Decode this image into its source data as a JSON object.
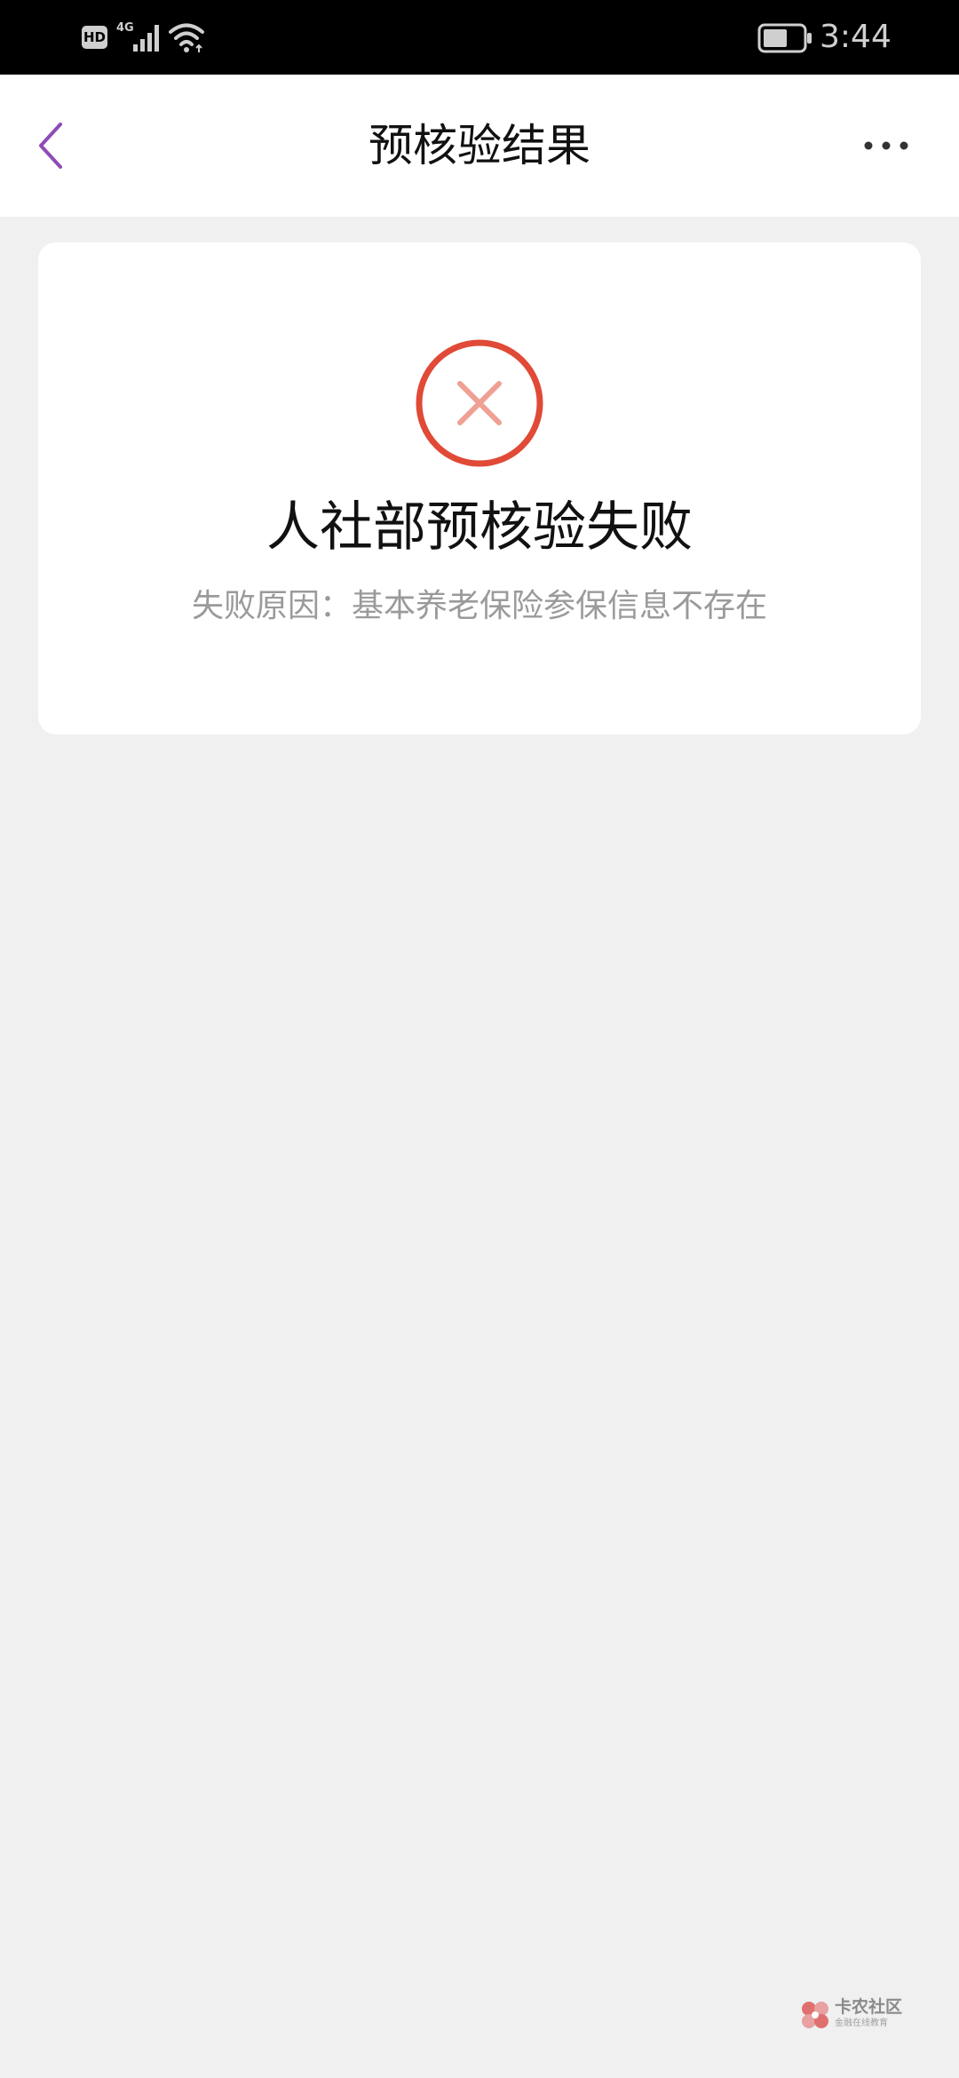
{
  "status_bar": {
    "hd_label": "HD",
    "network_label": "4G",
    "time": "3:44",
    "icons": [
      "hd-icon",
      "signal-icon",
      "wifi-icon",
      "battery-icon"
    ]
  },
  "header": {
    "title": "预核验结果",
    "back_icon": "chevron-left-icon",
    "more_icon": "more-dots-icon",
    "accent_color": "#8e4bb5"
  },
  "result": {
    "status_icon": "error-x-icon",
    "status_color": "#e04a36",
    "title": "人社部预核验失败",
    "reason": "失败原因：基本养老保险参保信息不存在"
  },
  "watermark": {
    "title": "卡农社区",
    "subtitle": "金融在线教育"
  }
}
